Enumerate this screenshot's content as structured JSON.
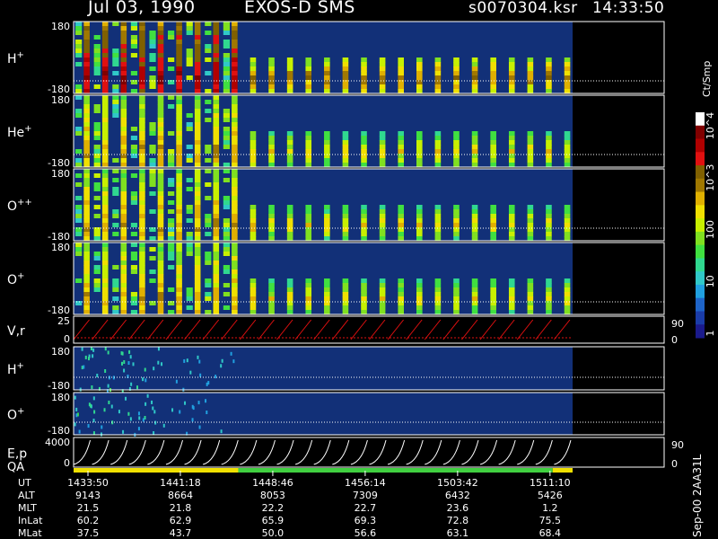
{
  "header": {
    "date": "Jul 03, 1990",
    "instrument": "EXOS-D SMS",
    "filename": "s0070304.ksr",
    "time": "14:33:50"
  },
  "colors": {
    "background": "#000000",
    "axis": "#ffffff",
    "panel_background": "#123078",
    "velocity_trace": "#e01010",
    "energy_trace": "#ffffff",
    "qa_yellow": "#f0e000",
    "qa_green": "#40d040",
    "dotted_line": "#ffffff"
  },
  "colorbar": {
    "unit_label": "Ct/Smp",
    "tick_labels": [
      "1",
      "10",
      "100",
      "10^3",
      "10^4"
    ],
    "colors": [
      "#1a1a8c",
      "#1a3ca8",
      "#1e64c8",
      "#20a0e0",
      "#30c8c8",
      "#30d890",
      "#40e040",
      "#80e020",
      "#c8f000",
      "#f0e000",
      "#e0b000",
      "#a07800",
      "#806000",
      "#e01010",
      "#b00000",
      "#800000",
      "#ffffff"
    ]
  },
  "footer_note": "Sep-00 2AA31L",
  "chart_data": {
    "type": "heatmap",
    "x": [
      "1433:50",
      "1441:18",
      "1448:46",
      "1456:14",
      "1503:42",
      "1511:10"
    ],
    "panels": [
      {
        "label_main": "H",
        "label_sup": "+",
        "ytop": "180",
        "ybottom": "-180",
        "ylim": [
          -180,
          180
        ],
        "kind": "pitch"
      },
      {
        "label_main": "He",
        "label_sup": "+",
        "ytop": "180",
        "ybottom": "-180",
        "ylim": [
          -180,
          180
        ],
        "kind": "pitch"
      },
      {
        "label_main": "O",
        "label_sup": "++",
        "ytop": "180",
        "ybottom": "-180",
        "ylim": [
          -180,
          180
        ],
        "kind": "pitch"
      },
      {
        "label_main": "O",
        "label_sup": "+",
        "ytop": "180",
        "ybottom": "-180",
        "ylim": [
          -180,
          180
        ],
        "kind": "pitch"
      },
      {
        "label_main": "V,r",
        "label_sup": "",
        "ytop": "25",
        "ybottom": "0",
        "ylim": [
          0,
          25
        ],
        "right_top": "90",
        "right_bottom": "0",
        "kind": "trace"
      },
      {
        "label_main": "H",
        "label_sup": "+",
        "ytop": "180",
        "ybottom": "-180",
        "ylim": [
          -180,
          180
        ],
        "kind": "pitch-low"
      },
      {
        "label_main": "O",
        "label_sup": "+",
        "ytop": "180",
        "ybottom": "-180",
        "ylim": [
          -180,
          180
        ],
        "kind": "pitch-low"
      },
      {
        "label_main": "E,p",
        "label_sup": "",
        "ytop": "4000",
        "ybottom": "0",
        "ylim": [
          0,
          4000
        ],
        "right_top": "90",
        "right_bottom": "0",
        "kind": "energy"
      }
    ],
    "qa_label": "QA",
    "qa_segments": [
      {
        "from": 0.0,
        "to": 0.33,
        "color": "yellow"
      },
      {
        "from": 0.33,
        "to": 0.96,
        "color": "green"
      },
      {
        "from": 0.96,
        "to": 1.0,
        "color": "yellow"
      }
    ],
    "ephemeris": [
      {
        "label": "UT",
        "values": [
          "1433:50",
          "1441:18",
          "1448:46",
          "1456:14",
          "1503:42",
          "1511:10"
        ]
      },
      {
        "label": "ALT",
        "values": [
          "9143",
          "8664",
          "8053",
          "7309",
          "6432",
          "5426"
        ]
      },
      {
        "label": "MLT",
        "values": [
          "21.5",
          "21.8",
          "22.2",
          "22.7",
          "23.6",
          "1.2"
        ]
      },
      {
        "label": "InLat",
        "values": [
          "60.2",
          "62.9",
          "65.9",
          "69.3",
          "72.8",
          "75.5"
        ]
      },
      {
        "label": "MLat",
        "values": [
          "37.5",
          "43.7",
          "50.0",
          "56.6",
          "63.1",
          "68.4"
        ]
      }
    ],
    "data_end_fraction": 0.845,
    "spin_count": 27
  }
}
